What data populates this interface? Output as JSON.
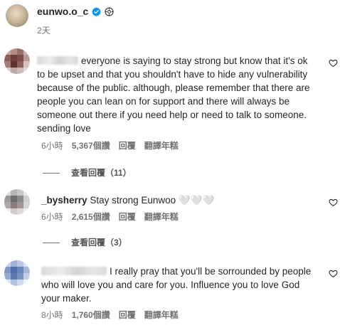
{
  "post": {
    "username": "eunwo.o_c",
    "time": "2天"
  },
  "comments": [
    {
      "username": "",
      "text": "everyone is saying to stay strong but know that it's ok to be upset and that you shouldn't have to hide any vulnerability because of the public. although, please remember that there are people you can lean on for support and there will always be someone out there if you need help or need to talk to someone. sending love",
      "time": "6小時",
      "likes": "5,367個讚",
      "reply_label": "回覆",
      "translate_label": "翻譯年糕",
      "view_replies": "查看回覆（11）"
    },
    {
      "username": "_bysherry",
      "text": "Stay strong Eunwoo 🤍🤍🤍",
      "time": "6小時",
      "likes": "2,615個讚",
      "reply_label": "回覆",
      "translate_label": "翻譯年糕",
      "view_replies": "查看回覆（3）"
    },
    {
      "username": "",
      "text": "I really pray that you'll be sorrounded by people who will love you and care for you. Influence you to love God your maker.",
      "time": "8小時",
      "likes": "1,760個讚",
      "reply_label": "回覆",
      "translate_label": "翻譯年糕"
    }
  ],
  "icons": {
    "verified": "verified-badge-icon",
    "cd": "cd-disc-icon",
    "heart": "heart-outline-icon"
  },
  "colors": {
    "verified": "#0095f6",
    "text": "#262626",
    "muted": "#737373"
  }
}
